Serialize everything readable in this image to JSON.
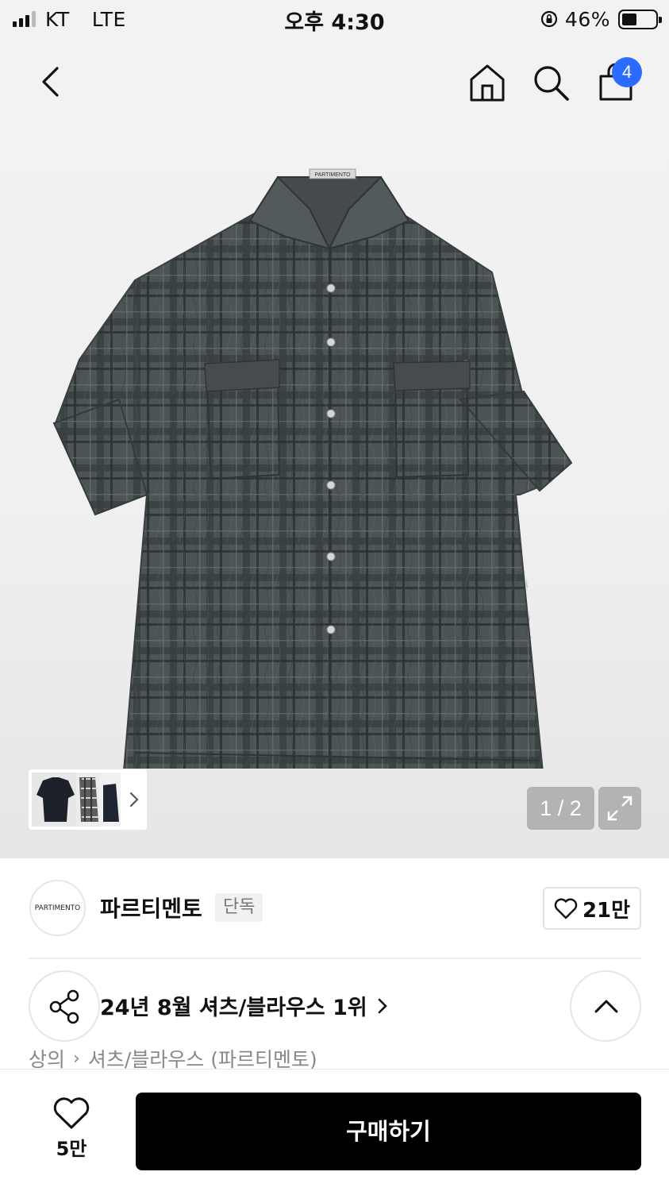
{
  "status_bar": {
    "carrier": "KT",
    "network": "LTE",
    "time": "오후 4:30",
    "battery_percent": "46%",
    "battery_level": 0.46
  },
  "nav": {
    "icons": [
      "back-icon",
      "home-icon",
      "search-icon",
      "cart-icon"
    ],
    "cart_count": "4"
  },
  "gallery": {
    "label_on_collar": "PARTIMENTO",
    "page_indicator": "1 / 2",
    "thumbnails": [
      "black-shirt",
      "checked-shirt",
      "navy-shirt"
    ]
  },
  "brand": {
    "logo_text": "PARTIMENTO",
    "name": "파르티멘토",
    "badge": "단독",
    "like_count": "21만"
  },
  "ranking": {
    "text": "24년 8월 셔츠/블라우스 1위"
  },
  "breadcrumb": {
    "items": [
      "상의",
      "셔츠/블라우스 (파르티멘토)"
    ]
  },
  "bottom_bar": {
    "wish_count": "5만",
    "buy_label": "구매하기"
  },
  "colors": {
    "badge_blue": "#2b6bff",
    "buy_button": "#000000",
    "shirt_base": "#4a5152"
  }
}
